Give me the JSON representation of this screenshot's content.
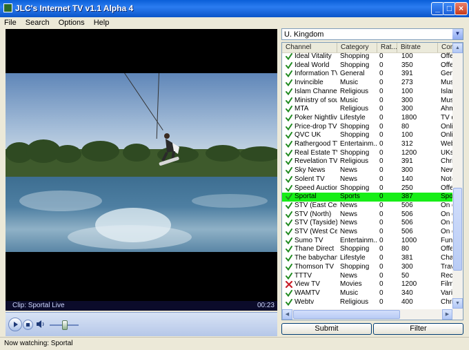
{
  "window": {
    "title": "JLC's Internet TV v1.1 Alpha 4"
  },
  "menu": [
    "File",
    "Search",
    "Options",
    "Help"
  ],
  "player": {
    "clip_label": "Clip: Sportal Live",
    "time": "00:23",
    "volume": 0.5
  },
  "country_select": {
    "value": "U. Kingdom"
  },
  "columns": [
    "Channel",
    "Category",
    "Rat...",
    "Bitrate",
    "Comm"
  ],
  "channels": [
    {
      "name": "Ideal Vitality",
      "category": "Shopping",
      "rating": "0",
      "bitrate": "100",
      "comment": "Offers",
      "status": "ok"
    },
    {
      "name": "Ideal World",
      "category": "Shopping",
      "rating": "0",
      "bitrate": "350",
      "comment": "Offers",
      "status": "ok"
    },
    {
      "name": "Information TV",
      "category": "General",
      "rating": "0",
      "bitrate": "391",
      "comment": "Gene",
      "status": "ok"
    },
    {
      "name": "Invincible",
      "category": "Music",
      "rating": "0",
      "bitrate": "273",
      "comment": "Music",
      "status": "ok"
    },
    {
      "name": "Islam Channel",
      "category": "Religious",
      "rating": "0",
      "bitrate": "100",
      "comment": "Islami",
      "status": "ok"
    },
    {
      "name": "Ministry of sound",
      "category": "Music",
      "rating": "0",
      "bitrate": "300",
      "comment": "Music",
      "status": "ok"
    },
    {
      "name": "MTA",
      "category": "Religious",
      "rating": "0",
      "bitrate": "300",
      "comment": "Ahma",
      "status": "ok"
    },
    {
      "name": "Poker Nightlive",
      "category": "Lifestyle",
      "rating": "0",
      "bitrate": "1800",
      "comment": "TV de",
      "status": "ok"
    },
    {
      "name": "Price-drop TV",
      "category": "Shopping",
      "rating": "0",
      "bitrate": "80",
      "comment": "Online",
      "status": "ok"
    },
    {
      "name": "QVC UK",
      "category": "Shopping",
      "rating": "0",
      "bitrate": "100",
      "comment": "Online",
      "status": "ok"
    },
    {
      "name": "Rathergood TV",
      "category": "Entertainm...",
      "rating": "0",
      "bitrate": "312",
      "comment": "Web",
      "status": "ok"
    },
    {
      "name": "Real Estate TV",
      "category": "Shopping",
      "rating": "0",
      "bitrate": "1200",
      "comment": "UKs c",
      "status": "ok"
    },
    {
      "name": "Revelation TV",
      "category": "Religious",
      "rating": "0",
      "bitrate": "391",
      "comment": "Christ",
      "status": "ok"
    },
    {
      "name": "Sky News",
      "category": "News",
      "rating": "0",
      "bitrate": "300",
      "comment": "News",
      "status": "ok"
    },
    {
      "name": "Solent TV",
      "category": "News",
      "rating": "0",
      "bitrate": "140",
      "comment": "Not-fo",
      "status": "ok"
    },
    {
      "name": "Speed Auction",
      "category": "Shopping",
      "rating": "0",
      "bitrate": "250",
      "comment": "Offers",
      "status": "ok"
    },
    {
      "name": "Sportal",
      "category": "Sports",
      "rating": "0",
      "bitrate": "387",
      "comment": "Sport",
      "status": "ok",
      "selected": true
    },
    {
      "name": "STV (East Cen...",
      "category": "News",
      "rating": "0",
      "bitrate": "506",
      "comment": "On de",
      "status": "ok"
    },
    {
      "name": "STV (North)",
      "category": "News",
      "rating": "0",
      "bitrate": "506",
      "comment": "On de",
      "status": "ok"
    },
    {
      "name": "STV (Tayside)",
      "category": "News",
      "rating": "0",
      "bitrate": "506",
      "comment": "On de",
      "status": "ok"
    },
    {
      "name": "STV (West Ce...",
      "category": "News",
      "rating": "0",
      "bitrate": "506",
      "comment": "On de",
      "status": "ok"
    },
    {
      "name": "Sumo TV",
      "category": "Entertainm...",
      "rating": "0",
      "bitrate": "1000",
      "comment": "Funny",
      "status": "ok"
    },
    {
      "name": "Thane Direct",
      "category": "Shopping",
      "rating": "0",
      "bitrate": "80",
      "comment": "Offers",
      "status": "ok"
    },
    {
      "name": "The babychan...",
      "category": "Lifestyle",
      "rating": "0",
      "bitrate": "381",
      "comment": "Chann",
      "status": "ok"
    },
    {
      "name": "Thomson TV",
      "category": "Shopping",
      "rating": "0",
      "bitrate": "300",
      "comment": "Trave",
      "status": "ok"
    },
    {
      "name": "TTTV",
      "category": "News",
      "rating": "0",
      "bitrate": "50",
      "comment": "Reco",
      "status": "ok"
    },
    {
      "name": "View TV",
      "category": "Movies",
      "rating": "0",
      "bitrate": "1200",
      "comment": "Film t",
      "status": "error"
    },
    {
      "name": "WAMTV",
      "category": "Music",
      "rating": "0",
      "bitrate": "340",
      "comment": "Variet",
      "status": "ok"
    },
    {
      "name": "Webtv",
      "category": "Religious",
      "rating": "0",
      "bitrate": "400",
      "comment": "Christ",
      "status": "ok"
    }
  ],
  "buttons": {
    "submit": "Submit",
    "filter": "Filter"
  },
  "status": {
    "text": "Now watching: Sportal"
  },
  "icons": {
    "ok": "check-icon",
    "error": "cross-icon"
  },
  "colors": {
    "selected_row": "#17ee17",
    "titlebar": "#0a5fd8"
  }
}
